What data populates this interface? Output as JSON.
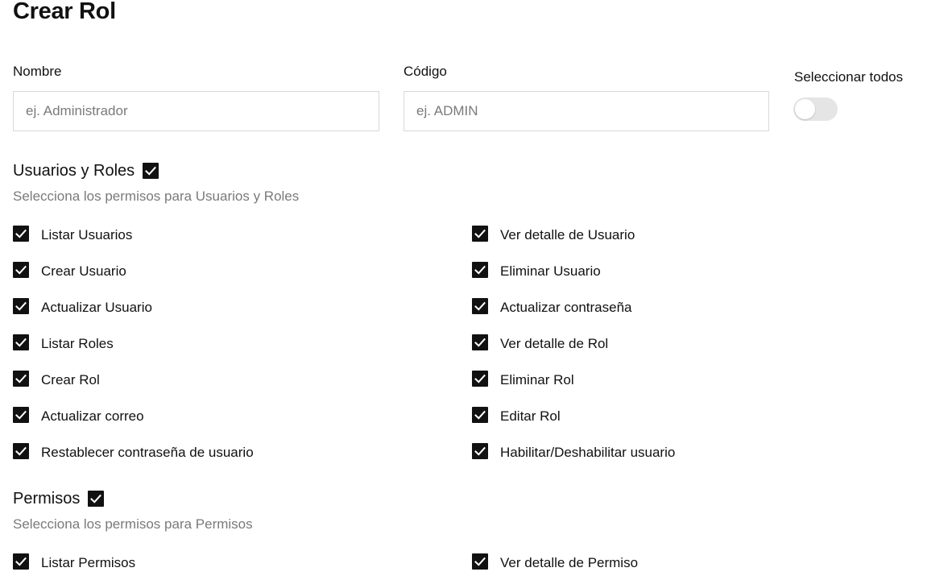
{
  "page": {
    "title": "Crear Rol"
  },
  "form": {
    "nombre_label": "Nombre",
    "nombre_value": "",
    "nombre_placeholder": "ej. Administrador",
    "codigo_label": "Código",
    "codigo_value": "",
    "codigo_placeholder": "ej. ADMIN",
    "select_all_label": "Seleccionar todos",
    "select_all_on": false
  },
  "sections": [
    {
      "title": "Usuarios y Roles",
      "checked": true,
      "description": "Selecciona los permisos para Usuarios y Roles",
      "permissions": [
        {
          "label": "Listar Usuarios",
          "checked": true
        },
        {
          "label": "Ver detalle de Usuario",
          "checked": true
        },
        {
          "label": "Crear Usuario",
          "checked": true
        },
        {
          "label": "Eliminar Usuario",
          "checked": true
        },
        {
          "label": "Actualizar Usuario",
          "checked": true
        },
        {
          "label": "Actualizar contraseña",
          "checked": true
        },
        {
          "label": "Listar Roles",
          "checked": true
        },
        {
          "label": "Ver detalle de Rol",
          "checked": true
        },
        {
          "label": "Crear Rol",
          "checked": true
        },
        {
          "label": "Eliminar Rol",
          "checked": true
        },
        {
          "label": "Actualizar correo",
          "checked": true
        },
        {
          "label": "Editar Rol",
          "checked": true
        },
        {
          "label": "Restablecer contraseña de usuario",
          "checked": true
        },
        {
          "label": "Habilitar/Deshabilitar usuario",
          "checked": true
        }
      ]
    },
    {
      "title": "Permisos",
      "checked": true,
      "description": "Selecciona los permisos para Permisos",
      "permissions": [
        {
          "label": "Listar Permisos",
          "checked": true
        },
        {
          "label": "Ver detalle de Permiso",
          "checked": true
        }
      ]
    }
  ],
  "colors": {
    "checkbox_fill": "#111111",
    "description_text": "#7a7a7a",
    "input_border": "#d9d9d9",
    "toggle_track": "#e5e5e5"
  },
  "icons": {
    "checkbox": "checkmark-icon",
    "toggle": "toggle-switch"
  }
}
